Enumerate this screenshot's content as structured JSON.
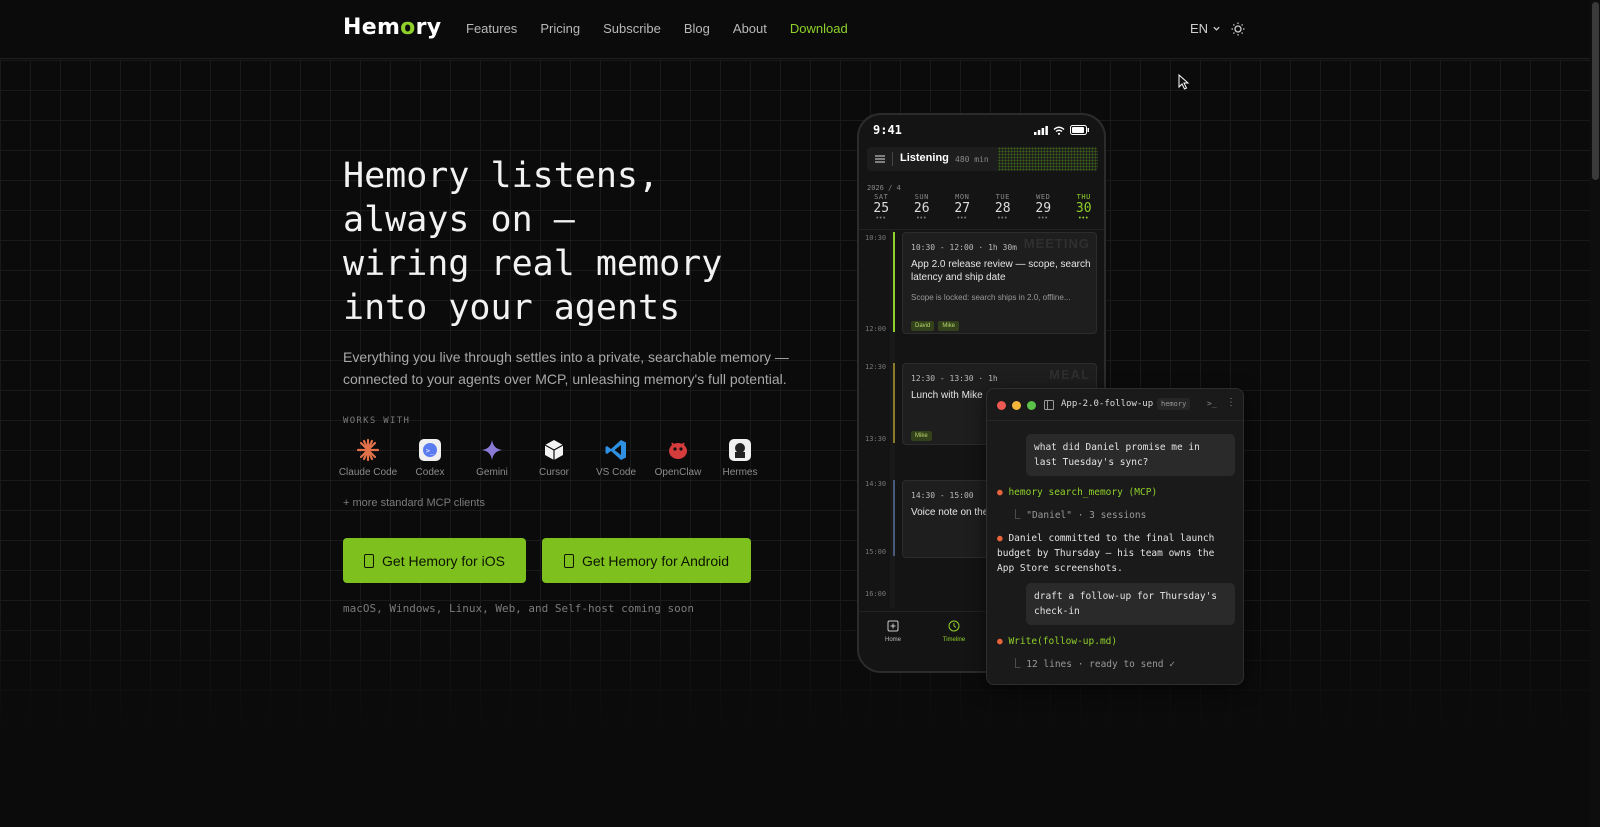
{
  "header": {
    "logo": {
      "pre": "H",
      "mid1": "em",
      "o": "o",
      "mid2": "ry"
    },
    "nav": [
      "Features",
      "Pricing",
      "Subscribe",
      "Blog",
      "About",
      "Download"
    ],
    "lang": "EN",
    "theme_icon": "sun-icon"
  },
  "hero": {
    "headline": "Hemory listens,\nalways on —\nwiring real memory\ninto your agents",
    "sub": "Everything you live through settles into a private, searchable memory — connected to your agents over MCP, unleashing memory's full potential.",
    "works_with": "WORKS WITH",
    "clients": [
      "Claude Code",
      "Codex",
      "Gemini",
      "Cursor",
      "VS Code",
      "OpenClaw",
      "Hermes"
    ],
    "more_clients": "+ more standard MCP clients",
    "btn_ios": "Get Hemory for iOS",
    "btn_android": "Get Hemory for Android",
    "coming_soon": "macOS, Windows, Linux, Web, and Self-host coming soon"
  },
  "phone": {
    "time": "9:41",
    "listening": "Listening",
    "listening_mins": "480 min",
    "month": "2026 / 4",
    "days": [
      {
        "name": "SAT",
        "num": "25"
      },
      {
        "name": "SUN",
        "num": "26"
      },
      {
        "name": "MON",
        "num": "27"
      },
      {
        "name": "TUE",
        "num": "28"
      },
      {
        "name": "WED",
        "num": "29"
      },
      {
        "name": "THU",
        "num": "30"
      }
    ],
    "dots": "•••",
    "times": [
      "10:30",
      "12:00",
      "12:30",
      "13:30",
      "14:30",
      "15:00",
      "16:00"
    ],
    "events": [
      {
        "time": "10:30 - 12:00 · 1h 30m",
        "category": "MEETING",
        "title": "App 2.0 release review — scope, search latency and ship date",
        "body": "Scope is locked: search ships in 2.0, offline...",
        "tags": [
          "David",
          "Mike"
        ]
      },
      {
        "time": "12:30 - 13:30 · 1h",
        "category": "MEAL",
        "title": "Lunch with Mike",
        "tags": [
          "Mike"
        ]
      },
      {
        "time": "14:30 - 15:00",
        "title": "Voice note on the"
      }
    ],
    "tabs": [
      "Home",
      "Timeline"
    ]
  },
  "terminal": {
    "title": "App-2.0-follow-up",
    "badge": "hemory",
    "prompt": ">_",
    "more": "⋮",
    "msg1": "what did Daniel promise me in last Tuesday's sync?",
    "tool1": "hemory search_memory (MCP)",
    "tool1_result": "\"Daniel\" · 3 sessions",
    "answer": "Daniel committed to the final launch budget by Thursday — his team owns the App Store screenshots.",
    "msg2": "draft a follow-up for Thursday's check-in",
    "tool2": "Write(follow-up.md)",
    "tool2_result": "12 lines · ready to send ✓"
  },
  "colors": {
    "accent": "#7ec11f",
    "accent_text": "#8fd12a",
    "background": "#0b0b0b"
  }
}
